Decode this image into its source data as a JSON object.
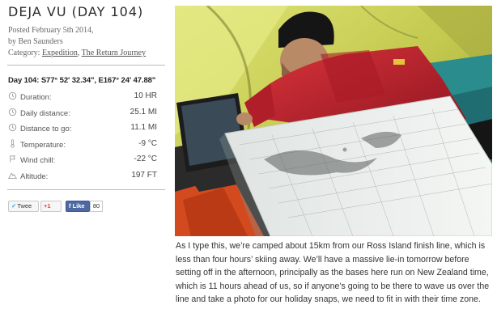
{
  "post": {
    "title": "DEJA VU (DAY 104)",
    "posted": "Posted February 5th 2014,",
    "author": "by Ben Saunders",
    "category_label": "Category:",
    "categories": [
      "Expedition",
      "The Return Journey"
    ],
    "category_separator": ","
  },
  "expedition": {
    "coordinates": "Day 104: S77° 52' 32.34\", E167° 24' 47.88\"",
    "stats": [
      {
        "icon": "clock-icon",
        "label": "Duration:",
        "value": "10 HR"
      },
      {
        "icon": "clock-icon",
        "label": "Daily distance:",
        "value": "25.1 MI"
      },
      {
        "icon": "clock-icon",
        "label": "Distance to go:",
        "value": "11.1 MI"
      },
      {
        "icon": "thermometer-icon",
        "label": "Temperature:",
        "value": "-9 °C"
      },
      {
        "icon": "wind-icon",
        "label": "Wind chill:",
        "value": "-22 °C"
      },
      {
        "icon": "mountain-icon",
        "label": "Altitude:",
        "value": "197 FT"
      }
    ]
  },
  "social": {
    "tweet": "Twee",
    "gplus": "+1",
    "fb_like": "Like",
    "fb_count": "80"
  },
  "article": {
    "text": "As I type this, we’re camped about 15km from our Ross Island finish line, which is less than four hours’ skiing away. We’ll have a massive lie-in tomorrow before setting off in the afternoon, principally as the bases here run on New Zealand time, which is 11 hours ahead of us, so if anyone’s going to be there to wave us over the line and take a photo for our holiday snaps, we need to fit in with their time zone."
  },
  "colors": {
    "tent": "#c9cf52",
    "jacket": "#c4202e",
    "map": "#e9ede9",
    "facebook": "#4e69a2"
  }
}
